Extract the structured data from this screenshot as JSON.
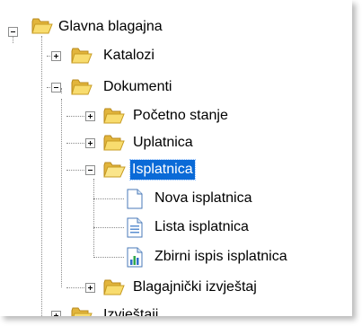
{
  "tree": {
    "root": {
      "label": "Glavna blagajna",
      "icon": "folder-icon"
    },
    "katalozi": {
      "label": "Katalozi",
      "icon": "folder-icon"
    },
    "dokumenti": {
      "label": "Dokumenti",
      "icon": "folder-icon"
    },
    "pocetno_stanje": {
      "label": "Početno stanje",
      "icon": "folder-icon"
    },
    "uplatnica": {
      "label": "Uplatnica",
      "icon": "folder-icon"
    },
    "isplatnica": {
      "label": "Isplatnica",
      "icon": "folder-open-icon",
      "selected": true
    },
    "nova_isplatnica": {
      "label": "Nova isplatnica",
      "icon": "new-document-icon"
    },
    "lista_isplatnica": {
      "label": "Lista isplatnica",
      "icon": "list-document-icon"
    },
    "zbirni_ispis": {
      "label": "Zbirni ispis isplatnica",
      "icon": "report-chart-icon"
    },
    "blagajnicki_izvjestaj": {
      "label": "Blagajnički izvještaj",
      "icon": "folder-icon"
    },
    "izvjestaji": {
      "label": "Izvještaji",
      "icon": "folder-icon"
    }
  },
  "colors": {
    "selection": "#0a6ad7",
    "folder_fill": "#f7d764",
    "folder_dark": "#d3a21d"
  }
}
